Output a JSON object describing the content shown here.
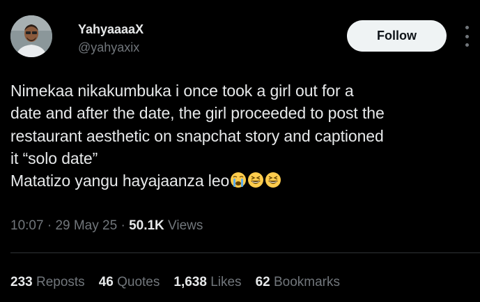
{
  "author": {
    "display_name": "YahyaaaaX",
    "handle": "@yahyaxix"
  },
  "follow_label": "Follow",
  "tweet": {
    "lines": [
      "Nimekaa nikakumbuka i once took a girl out for a",
      "date and after the date, the girl proceeded to post the",
      "restaurant aesthetic on snapchat story and captioned",
      "it “solo date”",
      "Matatizo yangu hayajaanza leo"
    ],
    "emojis": [
      "crying-face",
      "grinning-squinting-face",
      "grinning-squinting-face"
    ]
  },
  "meta": {
    "time": "10:07",
    "sep1": " · ",
    "date": "29 May 25",
    "sep2": " · ",
    "views_count": "50.1K",
    "views_label": " Views"
  },
  "stats": {
    "reposts_count": "233",
    "reposts_label": "Reposts",
    "quotes_count": "46",
    "quotes_label": "Quotes",
    "likes_count": "1,638",
    "likes_label": "Likes",
    "bookmarks_count": "62",
    "bookmarks_label": "Bookmarks"
  },
  "colors": {
    "background": "#000000",
    "text": "#e7e9ea",
    "muted": "#71767b",
    "button_bg": "#eff3f4"
  }
}
